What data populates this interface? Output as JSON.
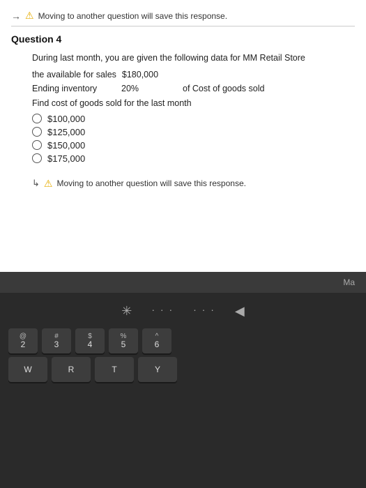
{
  "top_warning": {
    "arrow": "→",
    "icon": "⚠",
    "text": "Moving to another question will save this response."
  },
  "question": {
    "header": "Question 4",
    "intro": "During last month, you are given the following data for MM Retail Store",
    "data_rows": [
      {
        "label": "the available for sales",
        "value": "$180,000",
        "extra": ""
      },
      {
        "label": "Ending inventory",
        "value": "20%",
        "extra": "of Cost of goods sold"
      }
    ],
    "find_text": "Find cost of goods sold for the last month",
    "options": [
      "$100,000",
      "$125,000",
      "$150,000",
      "$175,000"
    ]
  },
  "bottom_warning": {
    "arrow": "↳",
    "icon": "⚠",
    "text": "Moving to another question will save this response."
  },
  "bezel": {
    "text": "Ma"
  },
  "keyboard": {
    "touchbar_icons": [
      "✳",
      "⋯",
      "⋯",
      "◀"
    ],
    "rows": [
      [
        {
          "top": "@",
          "bot": "2"
        },
        {
          "top": "#",
          "bot": "3"
        },
        {
          "top": "$",
          "bot": "4"
        },
        {
          "top": "%",
          "bot": "5"
        },
        {
          "top": "^",
          "bot": "6"
        }
      ],
      [
        {
          "top": "",
          "bot": "W"
        },
        {
          "top": "",
          "bot": ""
        }
      ]
    ]
  }
}
